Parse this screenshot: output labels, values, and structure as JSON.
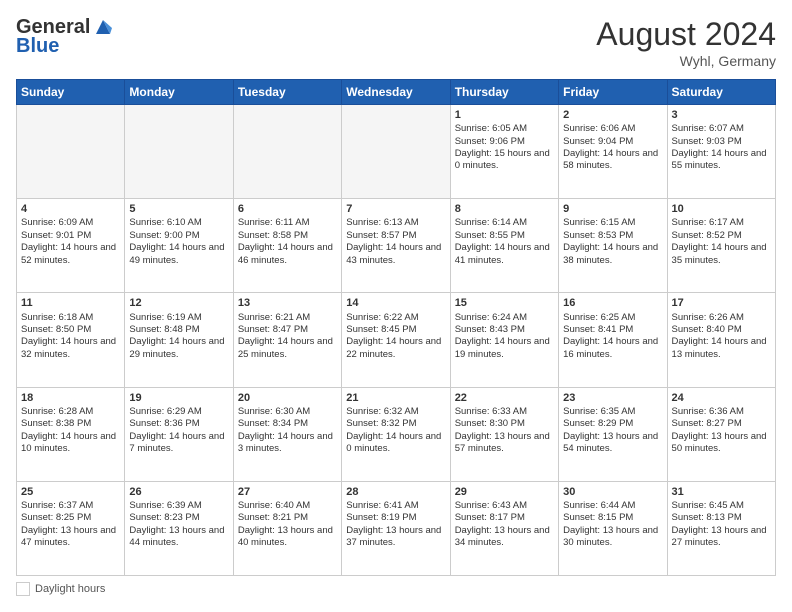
{
  "header": {
    "logo_line1": "General",
    "logo_line2": "Blue",
    "month_year": "August 2024",
    "location": "Wyhl, Germany"
  },
  "days_of_week": [
    "Sunday",
    "Monday",
    "Tuesday",
    "Wednesday",
    "Thursday",
    "Friday",
    "Saturday"
  ],
  "footer_label": "Daylight hours",
  "weeks": [
    [
      {
        "day": "",
        "empty": true
      },
      {
        "day": "",
        "empty": true
      },
      {
        "day": "",
        "empty": true
      },
      {
        "day": "",
        "empty": true
      },
      {
        "day": "1",
        "sunrise": "Sunrise: 6:05 AM",
        "sunset": "Sunset: 9:06 PM",
        "daylight": "Daylight: 15 hours and 0 minutes."
      },
      {
        "day": "2",
        "sunrise": "Sunrise: 6:06 AM",
        "sunset": "Sunset: 9:04 PM",
        "daylight": "Daylight: 14 hours and 58 minutes."
      },
      {
        "day": "3",
        "sunrise": "Sunrise: 6:07 AM",
        "sunset": "Sunset: 9:03 PM",
        "daylight": "Daylight: 14 hours and 55 minutes."
      }
    ],
    [
      {
        "day": "4",
        "sunrise": "Sunrise: 6:09 AM",
        "sunset": "Sunset: 9:01 PM",
        "daylight": "Daylight: 14 hours and 52 minutes."
      },
      {
        "day": "5",
        "sunrise": "Sunrise: 6:10 AM",
        "sunset": "Sunset: 9:00 PM",
        "daylight": "Daylight: 14 hours and 49 minutes."
      },
      {
        "day": "6",
        "sunrise": "Sunrise: 6:11 AM",
        "sunset": "Sunset: 8:58 PM",
        "daylight": "Daylight: 14 hours and 46 minutes."
      },
      {
        "day": "7",
        "sunrise": "Sunrise: 6:13 AM",
        "sunset": "Sunset: 8:57 PM",
        "daylight": "Daylight: 14 hours and 43 minutes."
      },
      {
        "day": "8",
        "sunrise": "Sunrise: 6:14 AM",
        "sunset": "Sunset: 8:55 PM",
        "daylight": "Daylight: 14 hours and 41 minutes."
      },
      {
        "day": "9",
        "sunrise": "Sunrise: 6:15 AM",
        "sunset": "Sunset: 8:53 PM",
        "daylight": "Daylight: 14 hours and 38 minutes."
      },
      {
        "day": "10",
        "sunrise": "Sunrise: 6:17 AM",
        "sunset": "Sunset: 8:52 PM",
        "daylight": "Daylight: 14 hours and 35 minutes."
      }
    ],
    [
      {
        "day": "11",
        "sunrise": "Sunrise: 6:18 AM",
        "sunset": "Sunset: 8:50 PM",
        "daylight": "Daylight: 14 hours and 32 minutes."
      },
      {
        "day": "12",
        "sunrise": "Sunrise: 6:19 AM",
        "sunset": "Sunset: 8:48 PM",
        "daylight": "Daylight: 14 hours and 29 minutes."
      },
      {
        "day": "13",
        "sunrise": "Sunrise: 6:21 AM",
        "sunset": "Sunset: 8:47 PM",
        "daylight": "Daylight: 14 hours and 25 minutes."
      },
      {
        "day": "14",
        "sunrise": "Sunrise: 6:22 AM",
        "sunset": "Sunset: 8:45 PM",
        "daylight": "Daylight: 14 hours and 22 minutes."
      },
      {
        "day": "15",
        "sunrise": "Sunrise: 6:24 AM",
        "sunset": "Sunset: 8:43 PM",
        "daylight": "Daylight: 14 hours and 19 minutes."
      },
      {
        "day": "16",
        "sunrise": "Sunrise: 6:25 AM",
        "sunset": "Sunset: 8:41 PM",
        "daylight": "Daylight: 14 hours and 16 minutes."
      },
      {
        "day": "17",
        "sunrise": "Sunrise: 6:26 AM",
        "sunset": "Sunset: 8:40 PM",
        "daylight": "Daylight: 14 hours and 13 minutes."
      }
    ],
    [
      {
        "day": "18",
        "sunrise": "Sunrise: 6:28 AM",
        "sunset": "Sunset: 8:38 PM",
        "daylight": "Daylight: 14 hours and 10 minutes."
      },
      {
        "day": "19",
        "sunrise": "Sunrise: 6:29 AM",
        "sunset": "Sunset: 8:36 PM",
        "daylight": "Daylight: 14 hours and 7 minutes."
      },
      {
        "day": "20",
        "sunrise": "Sunrise: 6:30 AM",
        "sunset": "Sunset: 8:34 PM",
        "daylight": "Daylight: 14 hours and 3 minutes."
      },
      {
        "day": "21",
        "sunrise": "Sunrise: 6:32 AM",
        "sunset": "Sunset: 8:32 PM",
        "daylight": "Daylight: 14 hours and 0 minutes."
      },
      {
        "day": "22",
        "sunrise": "Sunrise: 6:33 AM",
        "sunset": "Sunset: 8:30 PM",
        "daylight": "Daylight: 13 hours and 57 minutes."
      },
      {
        "day": "23",
        "sunrise": "Sunrise: 6:35 AM",
        "sunset": "Sunset: 8:29 PM",
        "daylight": "Daylight: 13 hours and 54 minutes."
      },
      {
        "day": "24",
        "sunrise": "Sunrise: 6:36 AM",
        "sunset": "Sunset: 8:27 PM",
        "daylight": "Daylight: 13 hours and 50 minutes."
      }
    ],
    [
      {
        "day": "25",
        "sunrise": "Sunrise: 6:37 AM",
        "sunset": "Sunset: 8:25 PM",
        "daylight": "Daylight: 13 hours and 47 minutes."
      },
      {
        "day": "26",
        "sunrise": "Sunrise: 6:39 AM",
        "sunset": "Sunset: 8:23 PM",
        "daylight": "Daylight: 13 hours and 44 minutes."
      },
      {
        "day": "27",
        "sunrise": "Sunrise: 6:40 AM",
        "sunset": "Sunset: 8:21 PM",
        "daylight": "Daylight: 13 hours and 40 minutes."
      },
      {
        "day": "28",
        "sunrise": "Sunrise: 6:41 AM",
        "sunset": "Sunset: 8:19 PM",
        "daylight": "Daylight: 13 hours and 37 minutes."
      },
      {
        "day": "29",
        "sunrise": "Sunrise: 6:43 AM",
        "sunset": "Sunset: 8:17 PM",
        "daylight": "Daylight: 13 hours and 34 minutes."
      },
      {
        "day": "30",
        "sunrise": "Sunrise: 6:44 AM",
        "sunset": "Sunset: 8:15 PM",
        "daylight": "Daylight: 13 hours and 30 minutes."
      },
      {
        "day": "31",
        "sunrise": "Sunrise: 6:45 AM",
        "sunset": "Sunset: 8:13 PM",
        "daylight": "Daylight: 13 hours and 27 minutes."
      }
    ]
  ]
}
